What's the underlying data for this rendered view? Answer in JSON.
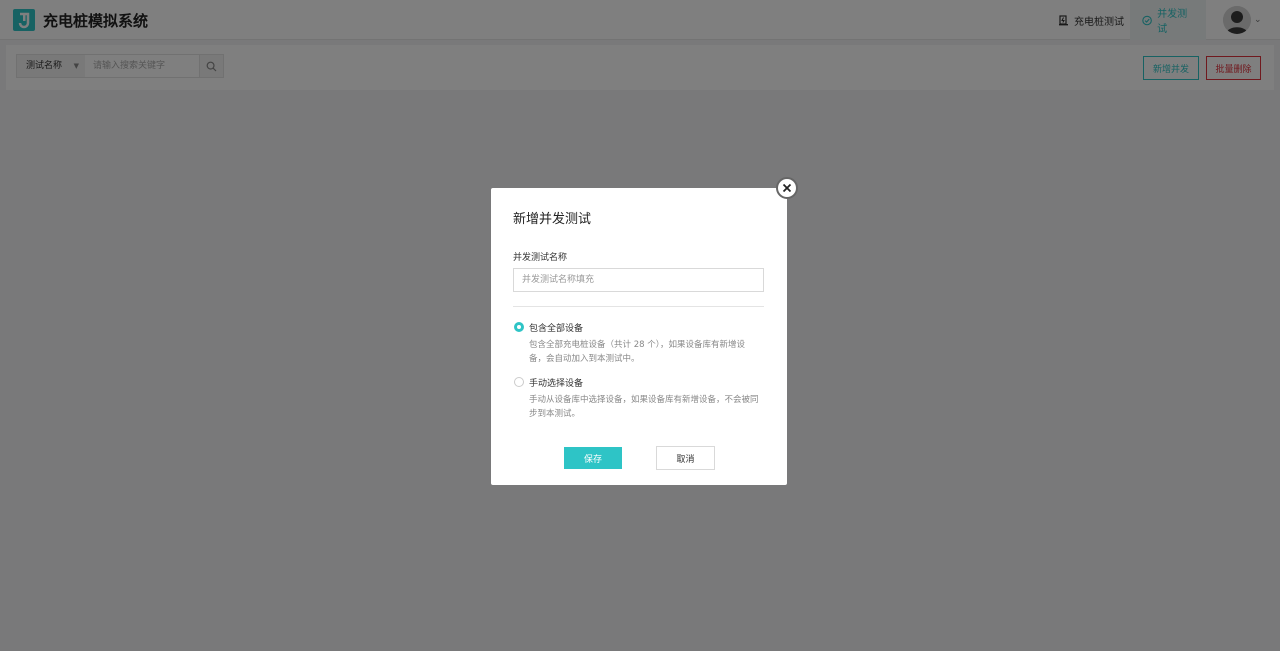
{
  "app": {
    "title": "充电桩模拟系统",
    "accent_color": "#2ec4c6",
    "danger_color": "#e0323d"
  },
  "header": {
    "nav": [
      {
        "label": "充电桩测试",
        "icon": "charging-pile-icon",
        "active": false
      },
      {
        "label": "并发测试",
        "icon": "check-circle-icon",
        "active": true
      }
    ],
    "avatar_icon": "user-avatar-icon",
    "avatar_caret": "⌄"
  },
  "toolbar": {
    "search_field": "测试名称",
    "search_placeholder": "请输入搜索关键字",
    "add_label": "新增并发",
    "delete_label": "批量删除"
  },
  "modal": {
    "title": "新增并发测试",
    "name_label": "并发测试名称",
    "name_placeholder": "并发测试名称填充",
    "name_value": "",
    "options": [
      {
        "label": "包含全部设备",
        "description": "包含全部充电桩设备（共计 28 个），如果设备库有新增设备，会自动加入到本测试中。",
        "checked": true
      },
      {
        "label": "手动选择设备",
        "description": "手动从设备库中选择设备，如果设备库有新增设备，不会被同步到本测试。",
        "checked": false
      }
    ],
    "save_label": "保存",
    "cancel_label": "取消"
  }
}
